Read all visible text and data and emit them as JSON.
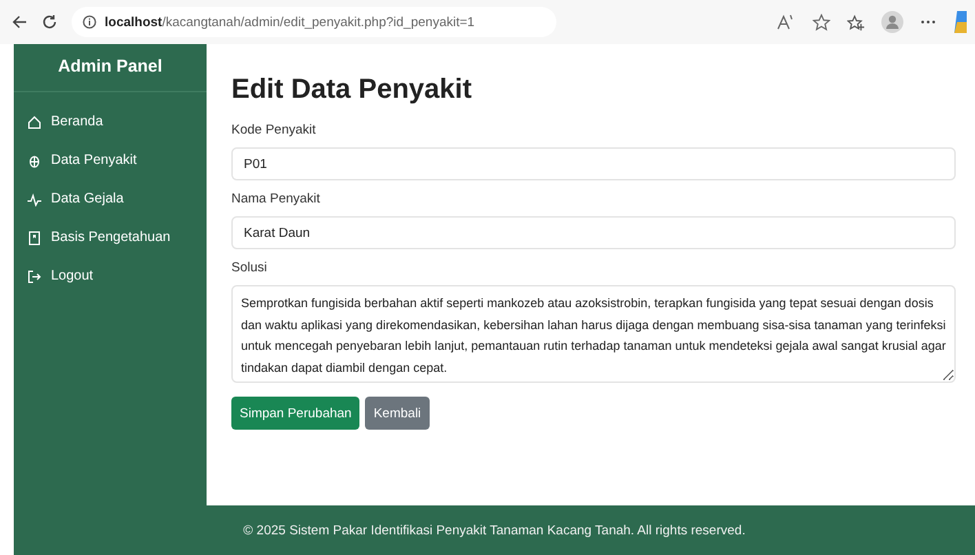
{
  "browser": {
    "url_host": "localhost",
    "url_path": "/kacangtanah/admin/edit_penyakit.php?id_penyakit=1"
  },
  "sidebar": {
    "title": "Admin Panel",
    "items": [
      {
        "label": "Beranda",
        "kind": "home"
      },
      {
        "label": "Data Penyakit",
        "kind": "disease"
      },
      {
        "label": "Data Gejala",
        "kind": "symptom"
      },
      {
        "label": "Basis Pengetahuan",
        "kind": "knowledge"
      },
      {
        "label": "Logout",
        "kind": "logout"
      }
    ]
  },
  "page": {
    "title": "Edit Data Penyakit",
    "fields": [
      {
        "label": "Kode Penyakit",
        "kind": "input",
        "value": "P01"
      },
      {
        "label": "Nama Penyakit",
        "kind": "input",
        "value": "Karat Daun"
      },
      {
        "label": "Solusi",
        "kind": "textarea",
        "value": "Semprotkan fungisida berbahan aktif seperti mankozeb atau azoksistrobin, terapkan fungisida yang tepat sesuai dengan dosis dan waktu aplikasi yang direkomendasikan, kebersihan lahan harus dijaga dengan membuang sisa-sisa tanaman yang terinfeksi untuk mencegah penyebaran lebih lanjut, pemantauan rutin terhadap tanaman untuk mendeteksi gejala awal sangat krusial agar tindakan dapat diambil dengan cepat."
      }
    ],
    "buttons": [
      {
        "label": "Simpan Perubahan",
        "kind": "primary"
      },
      {
        "label": "Kembali",
        "kind": "secondary"
      }
    ]
  },
  "footer": "© 2025 Sistem Pakar Identifikasi Penyakit Tanaman Kacang Tanah. All rights reserved."
}
